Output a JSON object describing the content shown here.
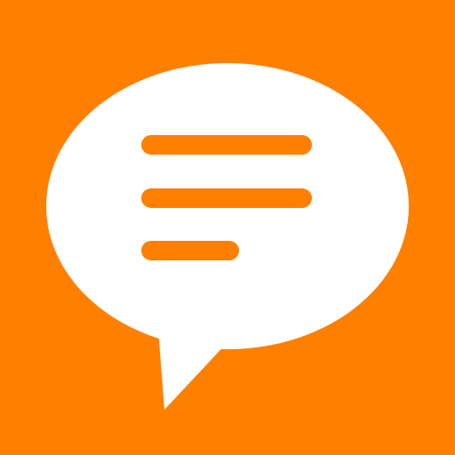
{
  "icon": {
    "name": "chat-bubble-icon",
    "background_color": "#FF7F00",
    "bubble_color": "#FFFFFF",
    "line_color": "#FF7F00",
    "text_lines_count": 3
  }
}
